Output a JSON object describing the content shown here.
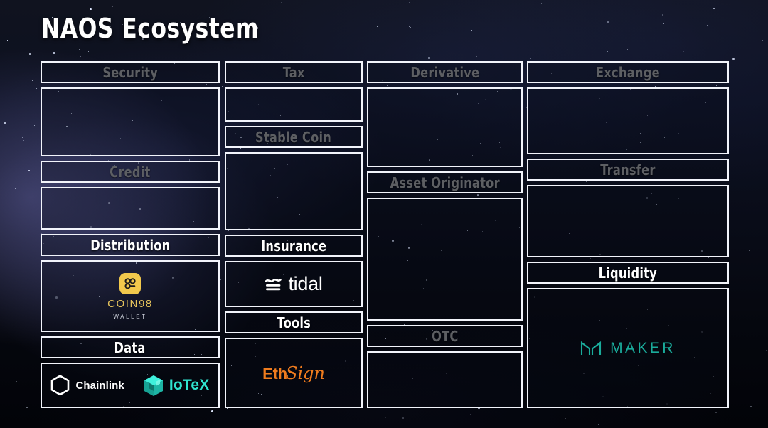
{
  "page": {
    "title": "NAOS Ecosystem",
    "background": "starfield-nebula",
    "colors": {
      "border": "#f2f4fb",
      "label_dim": "#5d5f63",
      "label_bright": "#ffffff",
      "coin98_gold": "#e6c45c",
      "iotex_teal": "#2fe3cf",
      "ethsign_orange": "#f07c1e",
      "maker_teal": "#1aab9b",
      "chainlink_white": "#ffffff"
    }
  },
  "columns": [
    {
      "name": "column-1",
      "cells": [
        {
          "type": "header",
          "label": "Security",
          "state": "dim"
        },
        {
          "type": "content",
          "logos": []
        },
        {
          "type": "header",
          "label": "Credit",
          "state": "dim"
        },
        {
          "type": "content",
          "logos": []
        },
        {
          "type": "header",
          "label": "Distribution",
          "state": "bright"
        },
        {
          "type": "content",
          "logos": [
            "coin98"
          ]
        },
        {
          "type": "header",
          "label": "Data",
          "state": "bright"
        },
        {
          "type": "content",
          "logos": [
            "chainlink",
            "iotex"
          ]
        }
      ]
    },
    {
      "name": "column-2",
      "cells": [
        {
          "type": "header",
          "label": "Tax",
          "state": "dim"
        },
        {
          "type": "content",
          "logos": []
        },
        {
          "type": "header",
          "label": "Stable Coin",
          "state": "dim"
        },
        {
          "type": "content",
          "logos": []
        },
        {
          "type": "header",
          "label": "Insurance",
          "state": "bright"
        },
        {
          "type": "content",
          "logos": [
            "tidal"
          ]
        },
        {
          "type": "header",
          "label": "Tools",
          "state": "bright"
        },
        {
          "type": "content",
          "logos": [
            "ethsign"
          ]
        }
      ]
    },
    {
      "name": "column-3",
      "cells": [
        {
          "type": "header",
          "label": "Derivative",
          "state": "dim"
        },
        {
          "type": "content",
          "logos": []
        },
        {
          "type": "header",
          "label": "Asset Originator",
          "state": "dim"
        },
        {
          "type": "content",
          "logos": []
        },
        {
          "type": "header",
          "label": "OTC",
          "state": "dim"
        },
        {
          "type": "content",
          "logos": []
        }
      ]
    },
    {
      "name": "column-4",
      "cells": [
        {
          "type": "header",
          "label": "Exchange",
          "state": "dim"
        },
        {
          "type": "content",
          "logos": []
        },
        {
          "type": "header",
          "label": "Transfer",
          "state": "dim"
        },
        {
          "type": "content",
          "logos": []
        },
        {
          "type": "header",
          "label": "Liquidity",
          "state": "bright"
        },
        {
          "type": "content",
          "logos": [
            "maker"
          ]
        }
      ]
    }
  ],
  "logos": {
    "coin98": {
      "name": "COIN98",
      "sub": "WALLET",
      "mark": "98"
    },
    "chainlink": {
      "name": "Chainlink",
      "mark": "hexagon"
    },
    "iotex": {
      "name": "IoTeX",
      "mark": "cube"
    },
    "tidal": {
      "name": "tidal",
      "mark": "waves"
    },
    "ethsign": {
      "name_bold": "Eth",
      "name_script": "Sign"
    },
    "maker": {
      "name": "MAKER",
      "mark": "m-monogram"
    }
  }
}
